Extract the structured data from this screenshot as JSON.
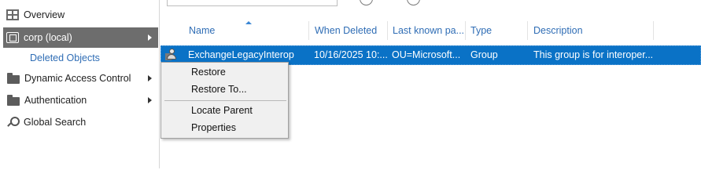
{
  "nav": {
    "items": [
      {
        "label": "Overview",
        "icon": "overview-icon"
      },
      {
        "label": "corp (local)",
        "icon": "domain-icon",
        "selected": true,
        "has_arrow": true
      },
      {
        "label": "Deleted Objects",
        "sub": true
      },
      {
        "label": "Dynamic Access Control",
        "icon": "folder-icon",
        "has_arrow": true
      },
      {
        "label": "Authentication",
        "icon": "folder-icon",
        "has_arrow": true
      },
      {
        "label": "Global Search",
        "icon": "search-icon"
      }
    ]
  },
  "columns": [
    "Name",
    "When Deleted",
    "Last known pa...",
    "Type",
    "Description"
  ],
  "sort": {
    "column": "Name",
    "direction": "ascending"
  },
  "rows": [
    {
      "name": "ExchangeLegacyInterop",
      "when_deleted": "10/16/2025 10:...",
      "last_known_parent": "OU=Microsoft...",
      "type": "Group",
      "description": "This group is for interoper...",
      "icon": "deleted-group-icon",
      "selected": true
    }
  ],
  "context_menu": {
    "items": [
      "Restore",
      "Restore To...",
      "Locate Parent",
      "Properties"
    ]
  },
  "colors": {
    "selection": "#0a72c6",
    "nav_selected": "#6d6d6d",
    "link": "#2f6db5"
  }
}
